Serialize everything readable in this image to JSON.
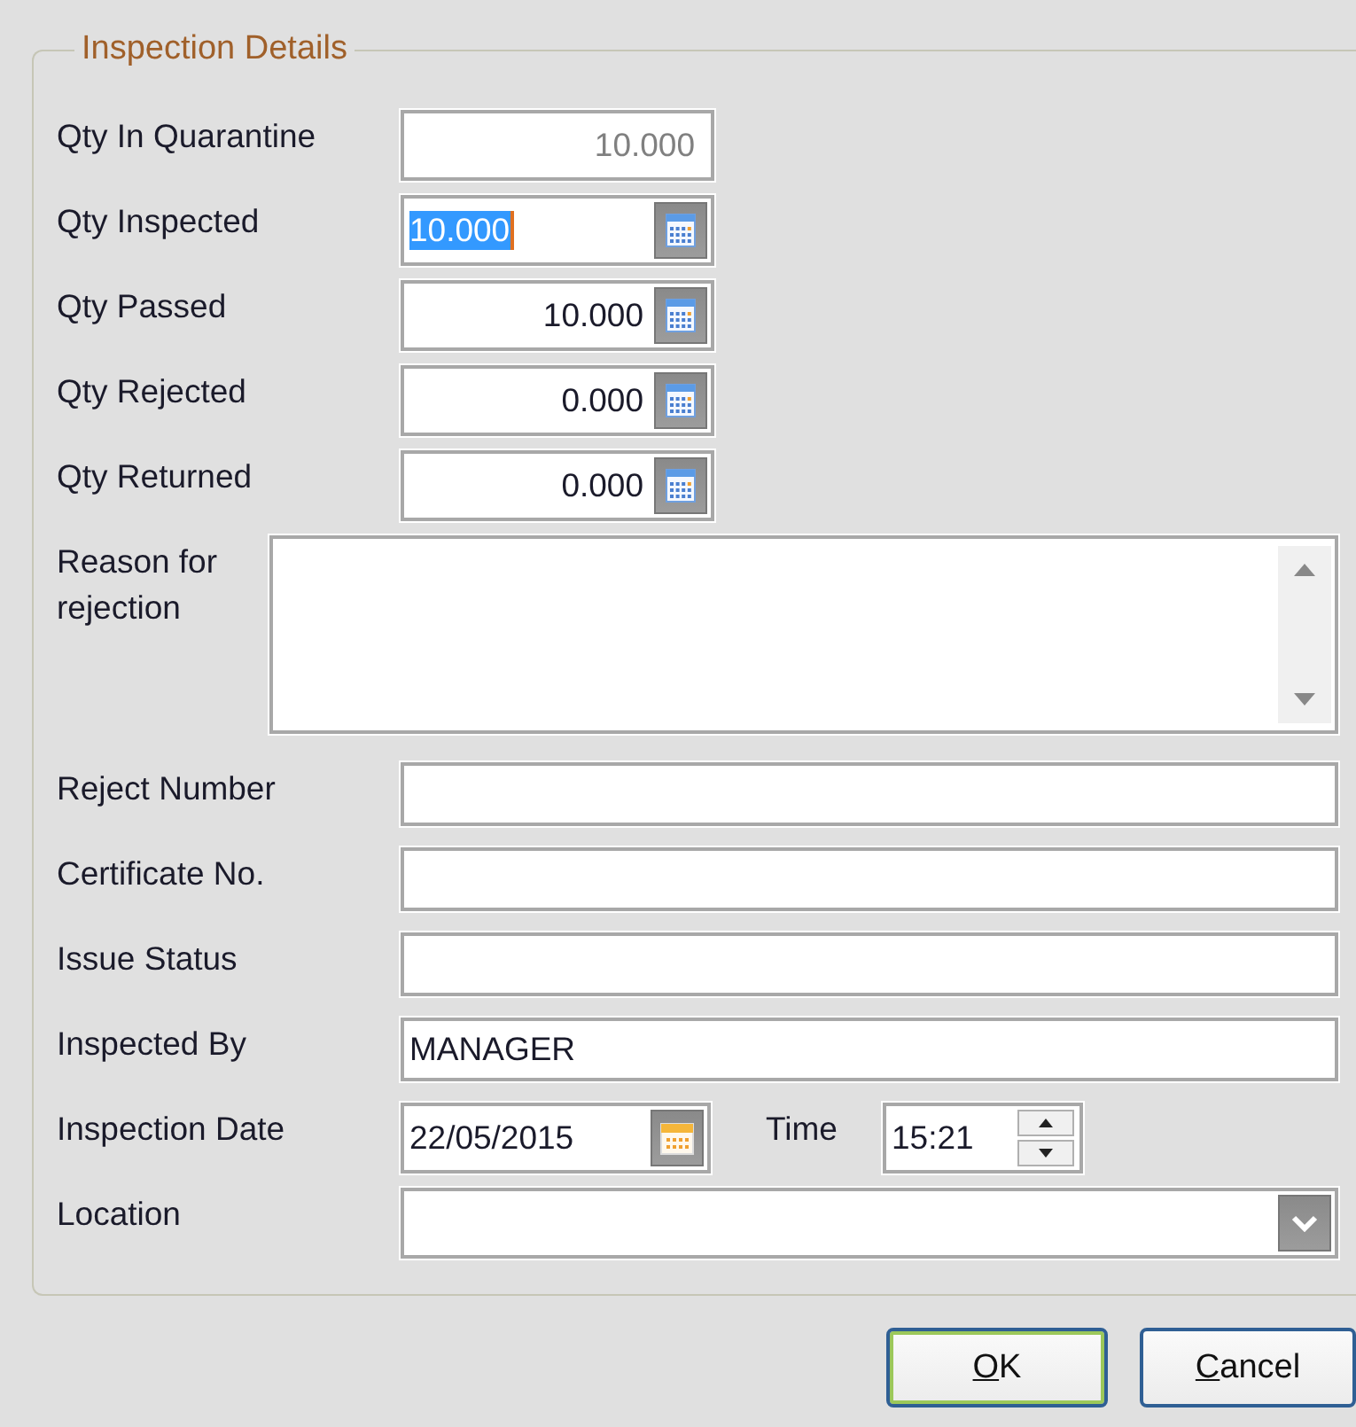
{
  "group": {
    "title": "Inspection Details"
  },
  "fields": [
    {
      "kind": "number",
      "label": "Qty In Quarantine",
      "value": "10.000",
      "disabled": true
    },
    {
      "kind": "calc",
      "label": "Qty Inspected",
      "value": "10.000",
      "text_selected": true
    },
    {
      "kind": "calc",
      "label": "Qty Passed",
      "value": "10.000",
      "text_selected": false
    },
    {
      "kind": "calc",
      "label": "Qty Rejected",
      "value": "0.000",
      "text_selected": false
    },
    {
      "kind": "calc",
      "label": "Qty Returned",
      "value": "0.000",
      "text_selected": false
    },
    {
      "kind": "memo",
      "label": "Reason for rejection"
    },
    {
      "kind": "text",
      "label": "Reject Number"
    },
    {
      "kind": "text",
      "label": "Certificate No."
    },
    {
      "kind": "text",
      "label": "Issue Status"
    },
    {
      "kind": "text",
      "label": "Inspected By",
      "value": "MANAGER"
    },
    {
      "kind": "datetime",
      "label": "Inspection Date",
      "value": "22/05/2015",
      "time_label": "Time",
      "time": "15:21"
    },
    {
      "kind": "combo",
      "label": "Location"
    }
  ],
  "buttons": [
    {
      "label": "OK",
      "default": true
    },
    {
      "label": "Cancel",
      "default": false
    }
  ]
}
